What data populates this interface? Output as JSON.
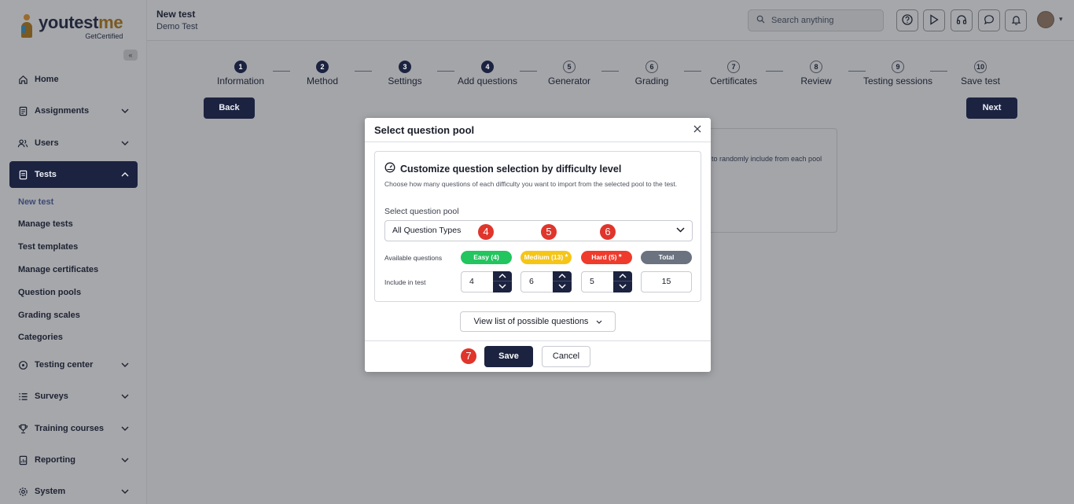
{
  "brand": {
    "name_a": "youtest",
    "name_b": "me",
    "tagline": "GetCertified"
  },
  "header": {
    "title": "New test",
    "subtitle": "Demo Test",
    "search_placeholder": "Search anything"
  },
  "sidebar": {
    "items": [
      {
        "label": "Home",
        "icon": "home-icon"
      },
      {
        "label": "Assignments",
        "icon": "assignments-icon"
      },
      {
        "label": "Users",
        "icon": "users-icon"
      },
      {
        "label": "Tests",
        "icon": "tests-icon",
        "active": true
      },
      {
        "label": "Testing center",
        "icon": "testing-center-icon"
      },
      {
        "label": "Surveys",
        "icon": "surveys-icon"
      },
      {
        "label": "Training courses",
        "icon": "trophy-icon"
      },
      {
        "label": "Reporting",
        "icon": "reporting-icon"
      },
      {
        "label": "System",
        "icon": "gear-icon"
      }
    ],
    "subitems": [
      "New test",
      "Manage tests",
      "Test templates",
      "Manage certificates",
      "Question pools",
      "Grading scales",
      "Categories"
    ]
  },
  "steps": [
    {
      "n": "1",
      "label": "Information",
      "done": true
    },
    {
      "n": "2",
      "label": "Method",
      "done": true
    },
    {
      "n": "3",
      "label": "Settings",
      "done": true
    },
    {
      "n": "4",
      "label": "Add questions",
      "done": true
    },
    {
      "n": "5",
      "label": "Generator",
      "done": false
    },
    {
      "n": "6",
      "label": "Grading",
      "done": false
    },
    {
      "n": "7",
      "label": "Certificates",
      "done": false
    },
    {
      "n": "8",
      "label": "Review",
      "done": false
    },
    {
      "n": "9",
      "label": "Testing sessions",
      "done": false
    },
    {
      "n": "10",
      "label": "Save test",
      "done": false
    }
  ],
  "nav": {
    "back": "Back",
    "next": "Next"
  },
  "background_card": {
    "text": "to randomly include from each pool"
  },
  "modal": {
    "title": "Select question pool",
    "panel_title": "Customize question selection by difficulty level",
    "panel_desc": "Choose how many questions of each difficulty you want to import from the selected pool to the test.",
    "pool_label": "Select question pool",
    "pool_value": "All Question Types",
    "available_label": "Available questions",
    "include_label": "Include in test",
    "easy": {
      "label": "Easy (4)",
      "value": "4",
      "color": "#22c55e"
    },
    "medium": {
      "label": "Medium (13)",
      "value": "6",
      "color": "#f5c518",
      "required": "*"
    },
    "hard": {
      "label": "Hard (5)",
      "value": "5",
      "color": "#ef3b2c",
      "required": "*"
    },
    "total": {
      "label": "Total",
      "value": "15",
      "color": "#6b7280"
    },
    "view_list": "View list of possible questions",
    "save": "Save",
    "cancel": "Cancel"
  },
  "callouts": [
    "4",
    "5",
    "6",
    "7"
  ]
}
